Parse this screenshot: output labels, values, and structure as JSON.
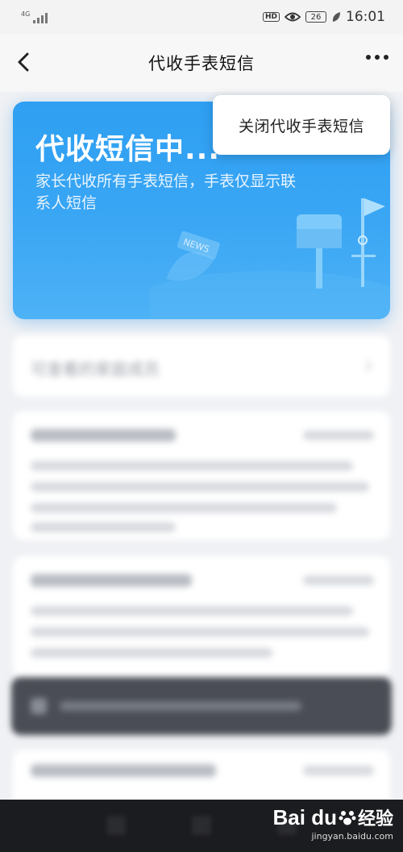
{
  "status_bar": {
    "network": "4G",
    "hd": "HD",
    "battery": "26",
    "time": "16:01"
  },
  "header": {
    "title": "代收手表短信"
  },
  "banner": {
    "title": "代收短信中...",
    "description": "家长代收所有手表短信，手表仅显示联系人短信",
    "art_badge": "NEWS"
  },
  "popup": {
    "close_label": "关闭代收手表短信"
  },
  "member_section": {
    "label": "可查看的家庭成员"
  },
  "colors": {
    "banner_blue": "#2e9ff2",
    "toast_dark": "#4a4d55"
  },
  "watermark": {
    "brand": "Bai du",
    "jingyan": "经验",
    "url": "jingyan.baidu.com"
  }
}
